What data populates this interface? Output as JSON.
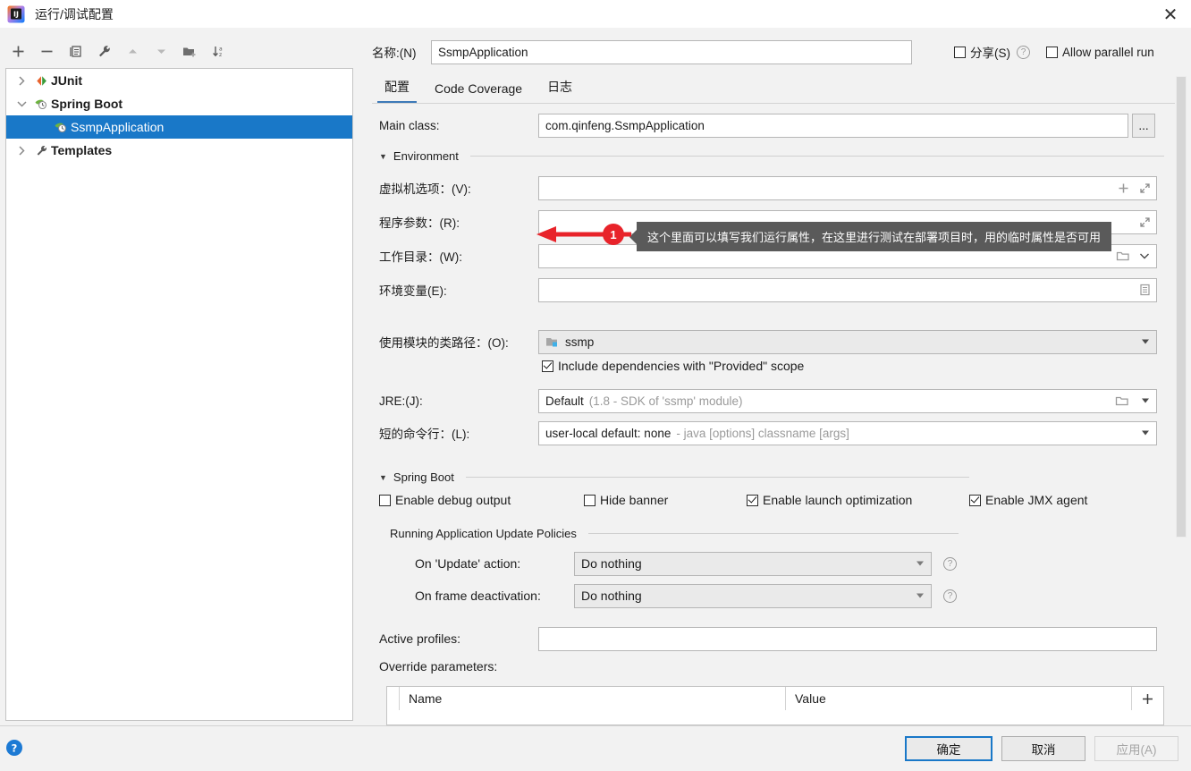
{
  "window": {
    "title": "运行/调试配置",
    "app_icon": "intellij-idea-logo",
    "close_label": "✕"
  },
  "left_panel": {
    "toolbar": [
      {
        "name": "add",
        "glyph": "+"
      },
      {
        "name": "remove",
        "glyph": "−"
      },
      {
        "name": "copy",
        "glyph": "copy-icon"
      },
      {
        "name": "edit-templates",
        "glyph": "wrench-icon"
      },
      {
        "name": "move-up",
        "glyph": "▲"
      },
      {
        "name": "move-down",
        "glyph": "▼"
      },
      {
        "name": "new-folder",
        "glyph": "folder-plus-icon"
      },
      {
        "name": "sort-alphabetically",
        "glyph": "sort-az-icon"
      }
    ],
    "tree": [
      {
        "label": "JUnit",
        "icon": "junit-icon",
        "twisty": "collapsed",
        "indent": 0,
        "bold": true,
        "selected": false
      },
      {
        "label": "Spring Boot",
        "icon": "spring-boot-icon",
        "twisty": "expanded",
        "indent": 0,
        "bold": true,
        "selected": false
      },
      {
        "label": "SsmpApplication",
        "icon": "spring-boot-icon",
        "twisty": "none",
        "indent": 1,
        "bold": false,
        "selected": true
      },
      {
        "label": "Templates",
        "icon": "wrench-icon",
        "twisty": "collapsed",
        "indent": 0,
        "bold": true,
        "selected": false
      }
    ]
  },
  "header": {
    "name_label": "名称:(N)",
    "name_value": "SsmpApplication",
    "share_label": "分享(S)",
    "share_checked": false,
    "share_help": "?",
    "allow_parallel_label": "Allow parallel run",
    "allow_parallel_checked": false
  },
  "tabs": [
    {
      "label": "配置",
      "active": true
    },
    {
      "label": "Code Coverage",
      "active": false
    },
    {
      "label": "日志",
      "active": false
    }
  ],
  "form": {
    "main_class_label": "Main class:",
    "main_class_value": "com.qinfeng.SsmpApplication",
    "main_class_browse": "...",
    "environment_section": "Environment",
    "vm_options_label": "虚拟机选项：(V):",
    "vm_options_value": "",
    "program_args_label": "程序参数：(R):",
    "program_args_value": "",
    "working_dir_label": "工作目录：(W):",
    "working_dir_value": "",
    "env_vars_label": "环境变量(E):",
    "env_vars_value": "",
    "module_classpath_label": "使用模块的类路径：(O):",
    "module_classpath_value": "ssmp",
    "include_provided_label": "Include dependencies with \"Provided\" scope",
    "include_provided_checked": true,
    "jre_label": "JRE:(J):",
    "jre_value": "Default",
    "jre_hint": "(1.8 - SDK of 'ssmp' module)",
    "shorten_cmdline_label": "短的命令行：(L):",
    "shorten_cmdline_value": "user-local default: none",
    "shorten_cmdline_hint": "- java [options] classname [args]"
  },
  "spring_boot": {
    "section": "Spring Boot",
    "checkboxes": [
      {
        "label": "Enable debug output",
        "checked": false
      },
      {
        "label": "Hide banner",
        "checked": false
      },
      {
        "label": "Enable launch optimization",
        "checked": true
      },
      {
        "label": "Enable JMX agent",
        "checked": true
      }
    ],
    "update_policies_section": "Running Application Update Policies",
    "on_update_label": "On 'Update' action:",
    "on_update_value": "Do nothing",
    "on_frame_label": "On frame deactivation:",
    "on_frame_value": "Do nothing",
    "help_glyph": "?",
    "active_profiles_label": "Active profiles:",
    "active_profiles_value": "",
    "override_params_label": "Override parameters:",
    "override_table": {
      "columns": [
        "Name",
        "Value"
      ],
      "rows": [],
      "add_glyph": "+"
    }
  },
  "annotation": {
    "badge_number": "1",
    "tooltip_text": "这个里面可以填写我们运行属性，在这里进行测试在部署项目时，用的临时属性是否可用",
    "arrow_color": "#e8232a"
  },
  "footer": {
    "help_glyph": "?",
    "ok_label": "确定",
    "cancel_label": "取消",
    "apply_label": "应用(A)",
    "apply_disabled": true
  },
  "colors": {
    "selection_blue": "#1978c8",
    "tab_underline": "#3d7ab8",
    "tooltip_bg": "#5a5a5a",
    "accent_red": "#e8232a",
    "dialog_bg": "#f2f2f2"
  }
}
